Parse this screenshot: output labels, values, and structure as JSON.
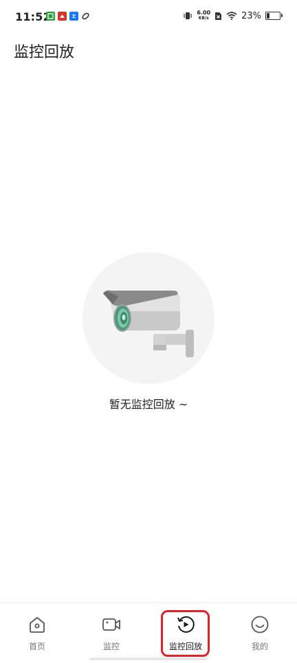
{
  "status_bar": {
    "time": "11:52",
    "net_speed_value": "6.00",
    "net_speed_unit": "KB/s",
    "battery_percent": "23%",
    "battery_level": 0.23
  },
  "header": {
    "title": "监控回放"
  },
  "empty_state": {
    "message": "暂无监控回放 ~"
  },
  "bottom_nav": {
    "items": [
      {
        "label": "首页",
        "icon": "home-icon"
      },
      {
        "label": "监控",
        "icon": "video-camera-icon"
      },
      {
        "label": "监控回放",
        "icon": "replay-icon",
        "active": true
      },
      {
        "label": "我的",
        "icon": "smile-profile-icon"
      }
    ],
    "highlight_color": "#e0202a"
  }
}
